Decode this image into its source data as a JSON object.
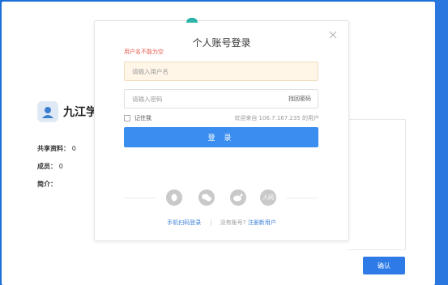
{
  "background": {
    "group": {
      "name": "九江学",
      "shared_label": "共享资料：",
      "shared_count": "0",
      "members_label": "成员：",
      "members_count": "0",
      "intro_label": "简介："
    },
    "confirm_label": "确认"
  },
  "modal": {
    "title": "个人账号登录",
    "error": "用户名不能为空",
    "username_placeholder": "请输入用户名",
    "password_placeholder": "请输入密码",
    "forgot_label": "找回密码",
    "remember_label": "记住我",
    "welcome_text": "欢迎来自 106.7.167.235 的用户",
    "login_label": "登 录",
    "social": [
      "qq-icon",
      "wechat-icon",
      "weibo-icon",
      "renren-icon"
    ],
    "renren_text": "人网",
    "phone_login": "手机扫码登录",
    "no_account": "没有账号?",
    "register": "注册新用户"
  },
  "colors": {
    "accent": "#3a8ef0",
    "frame": "#1f6fd8",
    "error": "#e85a4f",
    "input_highlight": "#fff6e8"
  }
}
